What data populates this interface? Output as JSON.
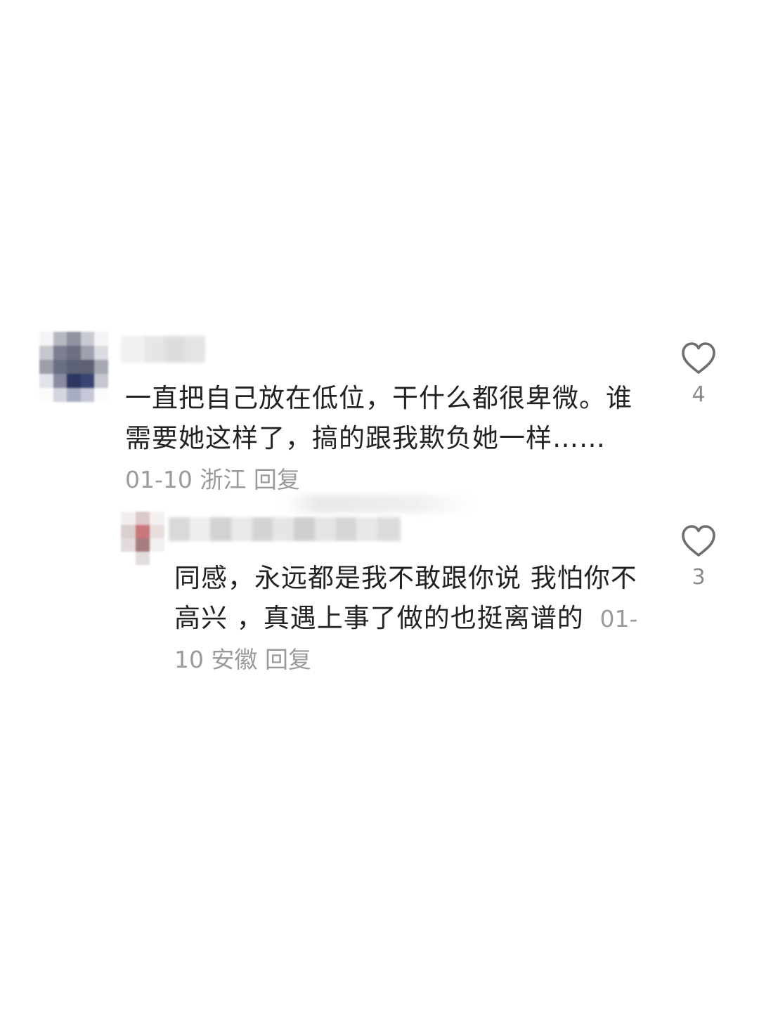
{
  "comments": [
    {
      "text": "一直把自己放在低位，干什么都很卑微。谁需要她这样了，搞的跟我欺负她一样……",
      "date": "01-10",
      "location": "浙江",
      "reply_label": "回复",
      "likes": "4",
      "like_icon": "heart-outline-icon"
    },
    {
      "text": "同感，永远都是我不敢跟你说 我怕你不高兴 ，真遇上事了做的也挺离谱的",
      "date": "01-10",
      "location": "安徽",
      "reply_label": "回复",
      "likes": "3",
      "like_icon": "heart-outline-icon"
    }
  ],
  "colors": {
    "text": "#222222",
    "meta": "#9a9a9a",
    "like_count": "#8a8a8a",
    "icon_stroke": "#6e6e6e"
  }
}
